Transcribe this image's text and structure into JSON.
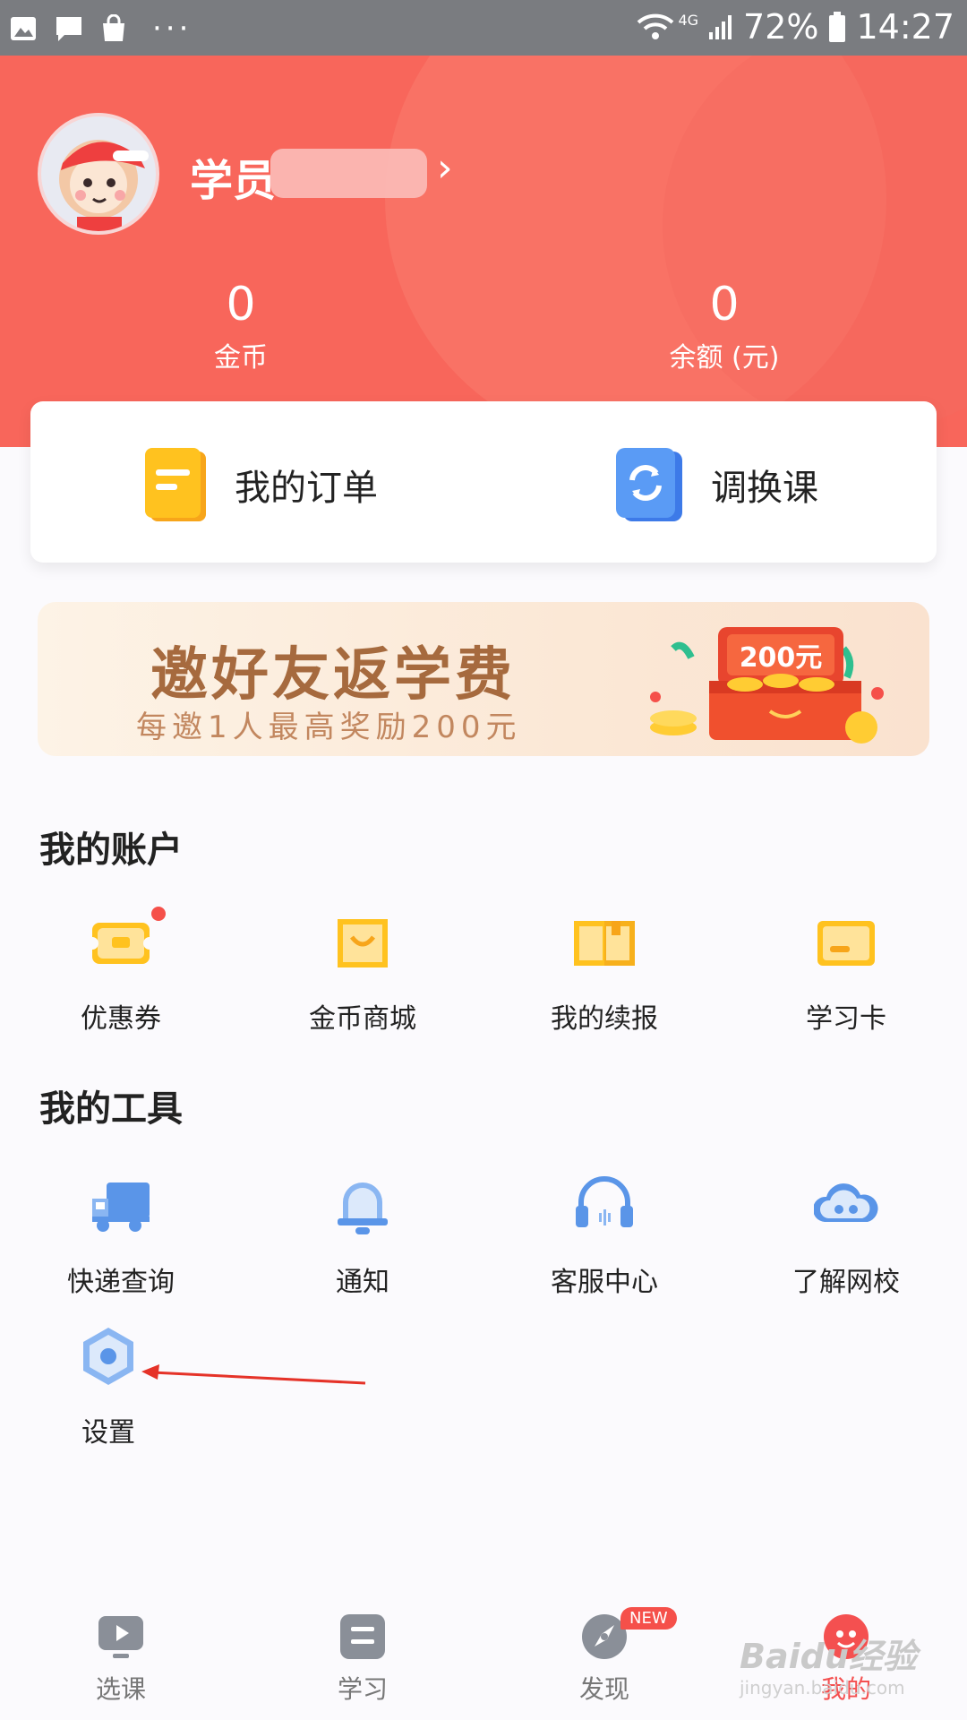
{
  "status_bar": {
    "battery": "72%",
    "time": "14:27",
    "signal": "4G"
  },
  "profile": {
    "name_prefix": "学员",
    "stats": [
      {
        "value": "0",
        "label": "金币"
      },
      {
        "value": "0",
        "label": "余额 (元)"
      }
    ]
  },
  "quick_card": [
    {
      "label": "我的订单",
      "icon": "order-icon"
    },
    {
      "label": "调换课",
      "icon": "swap-course-icon"
    }
  ],
  "banner": {
    "title": "邀好友返学费",
    "subtitle": "每邀1人最高奖励200元",
    "badge": "200元"
  },
  "account": {
    "title": "我的账户",
    "items": [
      {
        "label": "优惠券",
        "icon": "coupon-icon",
        "has_dot": true
      },
      {
        "label": "金币商城",
        "icon": "shopping-bag-icon"
      },
      {
        "label": "我的续报",
        "icon": "book-icon"
      },
      {
        "label": "学习卡",
        "icon": "card-icon"
      }
    ]
  },
  "tools": {
    "title": "我的工具",
    "items": [
      {
        "label": "快递查询",
        "icon": "delivery-truck-icon"
      },
      {
        "label": "通知",
        "icon": "bell-icon"
      },
      {
        "label": "客服中心",
        "icon": "headset-icon"
      },
      {
        "label": "了解网校",
        "icon": "cloud-face-icon"
      },
      {
        "label": "设置",
        "icon": "settings-hexagon-icon"
      }
    ]
  },
  "tabbar": {
    "items": [
      {
        "label": "选课",
        "icon": "play-icon"
      },
      {
        "label": "学习",
        "icon": "study-icon"
      },
      {
        "label": "发现",
        "icon": "discover-icon",
        "badge": "NEW"
      },
      {
        "label": "我的",
        "icon": "profile-icon",
        "active": true
      }
    ]
  },
  "watermark": {
    "line1": "Baidu经验",
    "line2": "jingyan.baidu.com"
  },
  "colors": {
    "primary_red": "#f8665b",
    "accent_orange": "#ffb21a",
    "accent_blue": "#4d8cf5",
    "icon_blue": "#5a95e8"
  }
}
